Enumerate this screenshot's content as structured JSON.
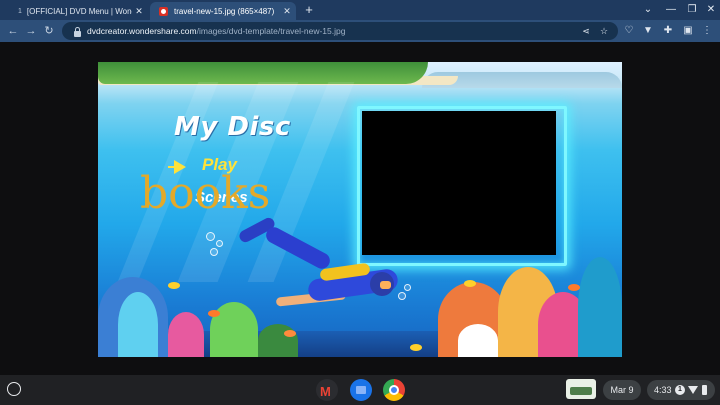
{
  "browser": {
    "tabs": [
      {
        "number": "1",
        "title": "[OFFICIAL] DVD Menu | Wonders",
        "active": false
      },
      {
        "title": "travel-new-15.jpg (865×487)",
        "active": true
      }
    ],
    "new_tab_glyph": "+",
    "tab_close_glyph": "✕",
    "url_host": "dvdcreator.wondershare.com",
    "url_path": "/images/dvd-template/travel-new-15.jpg",
    "icons": [
      "back-arrow-icon",
      "forward-arrow-icon",
      "reload-icon",
      "lock-icon",
      "share-icon",
      "star-icon",
      "extension-icon",
      "puzzle-icon",
      "side-panel-icon",
      "menu-icon",
      "chevron-down-icon",
      "minimize-icon",
      "restore-icon",
      "close-icon"
    ]
  },
  "dvd_menu": {
    "title": "My Disc",
    "play_label": "Play",
    "scenes_label": "Scenes",
    "overlay_text": "books",
    "colors": {
      "accent": "#ffe23a",
      "frame": "#7ff7ff",
      "overlay": "#e3a92a"
    }
  },
  "shelf": {
    "date": "Mar 9",
    "time": "4:33",
    "notification_count": "1",
    "apps": [
      "gmail-icon",
      "files-icon",
      "chrome-icon"
    ]
  }
}
